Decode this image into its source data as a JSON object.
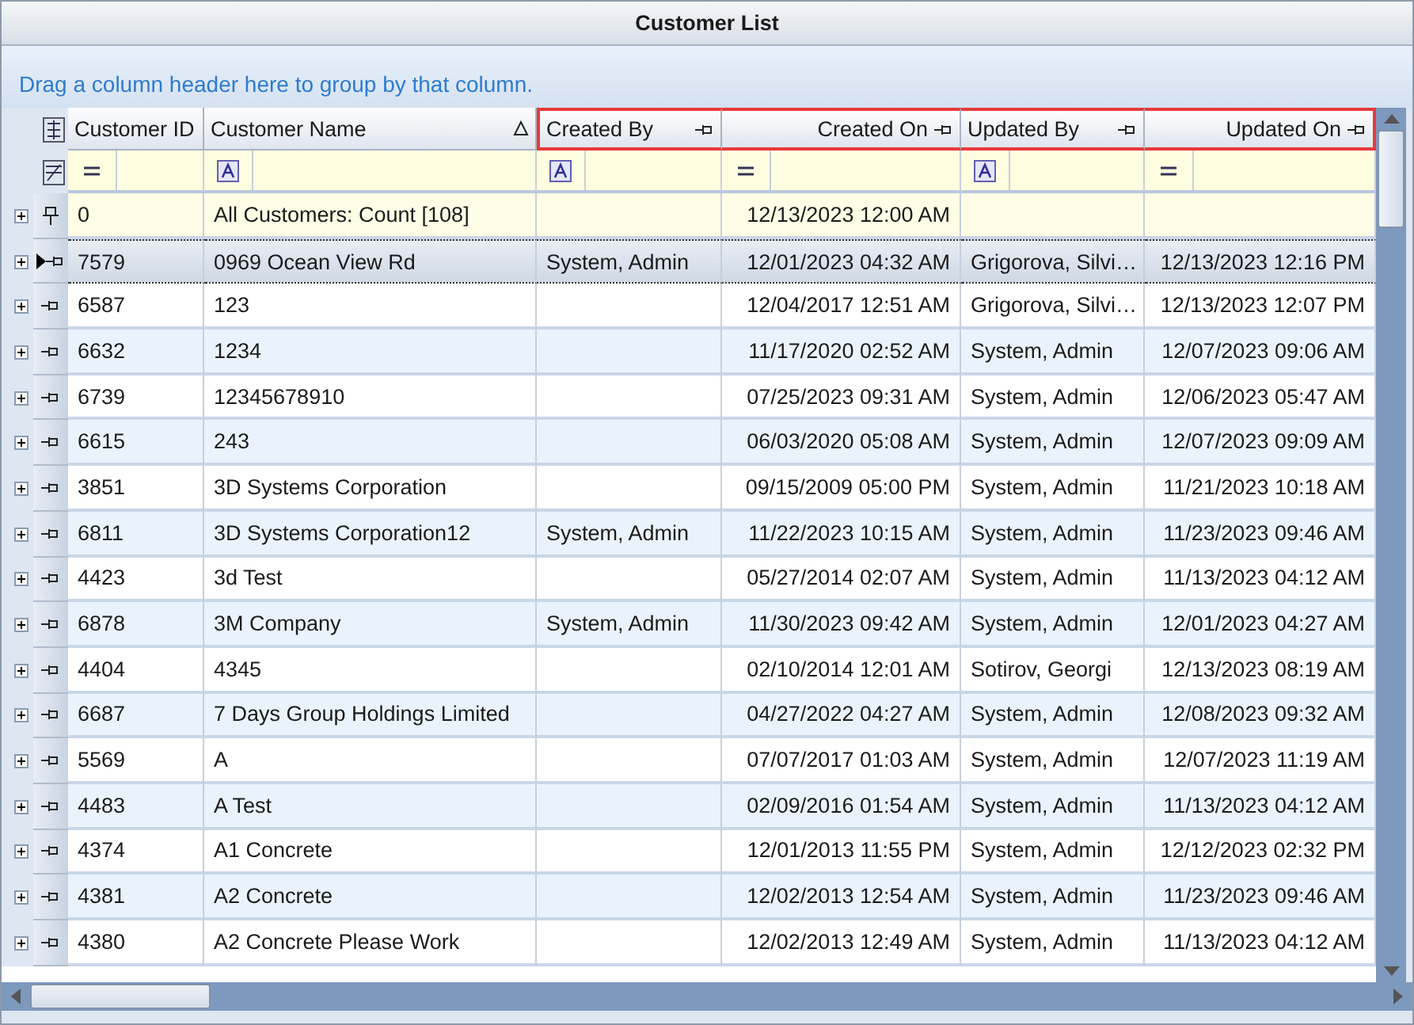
{
  "window": {
    "title": "Customer List"
  },
  "group_panel": {
    "hint": "Drag a column header here to group by that column."
  },
  "columns": [
    {
      "label": "Customer ID",
      "right_aligned": false,
      "sorted": false,
      "pinned": false,
      "highlighted": false
    },
    {
      "label": "Customer Name",
      "right_aligned": false,
      "sorted": true,
      "pinned": false,
      "highlighted": false
    },
    {
      "label": "Created By",
      "right_aligned": false,
      "sorted": false,
      "pinned": true,
      "highlighted": true
    },
    {
      "label": "Created On",
      "right_aligned": true,
      "sorted": false,
      "pinned": true,
      "highlighted": true
    },
    {
      "label": "Updated By",
      "right_aligned": false,
      "sorted": false,
      "pinned": true,
      "highlighted": true
    },
    {
      "label": "Updated On",
      "right_aligned": true,
      "sorted": false,
      "pinned": true,
      "highlighted": true
    }
  ],
  "filter_row": [
    {
      "kind": "equals"
    },
    {
      "kind": "text"
    },
    {
      "kind": "text"
    },
    {
      "kind": "equals"
    },
    {
      "kind": "text"
    },
    {
      "kind": "equals"
    }
  ],
  "rows": [
    {
      "kind": "summary",
      "selected": false,
      "cells": [
        "0",
        "All Customers: Count [108]",
        null,
        "12/13/2023 12:00 AM",
        null,
        null
      ]
    },
    {
      "kind": "data",
      "selected": true,
      "cells": [
        "7579",
        "0969 Ocean View Rd",
        "System, Admin",
        "12/01/2023 04:32 AM",
        "Grigorova, Silvi…",
        "12/13/2023 12:16 PM"
      ]
    },
    {
      "kind": "data",
      "selected": false,
      "cells": [
        "6587",
        "123",
        null,
        "12/04/2017 12:51 AM",
        "Grigorova, Silvi…",
        "12/13/2023 12:07 PM"
      ]
    },
    {
      "kind": "data",
      "selected": false,
      "cells": [
        "6632",
        "1234",
        null,
        "11/17/2020 02:52 AM",
        "System, Admin",
        "12/07/2023 09:06 AM"
      ]
    },
    {
      "kind": "data",
      "selected": false,
      "cells": [
        "6739",
        "12345678910",
        null,
        "07/25/2023 09:31 AM",
        "System, Admin",
        "12/06/2023 05:47 AM"
      ]
    },
    {
      "kind": "data",
      "selected": false,
      "cells": [
        "6615",
        "243",
        null,
        "06/03/2020 05:08 AM",
        "System, Admin",
        "12/07/2023 09:09 AM"
      ]
    },
    {
      "kind": "data",
      "selected": false,
      "cells": [
        "3851",
        "3D Systems Corporation",
        null,
        "09/15/2009 05:00 PM",
        "System, Admin",
        "11/21/2023 10:18 AM"
      ]
    },
    {
      "kind": "data",
      "selected": false,
      "cells": [
        "6811",
        "3D Systems Corporation12",
        "System, Admin",
        "11/22/2023 10:15 AM",
        "System, Admin",
        "11/23/2023 09:46 AM"
      ]
    },
    {
      "kind": "data",
      "selected": false,
      "cells": [
        "4423",
        "3d Test",
        null,
        "05/27/2014 02:07 AM",
        "System, Admin",
        "11/13/2023 04:12 AM"
      ]
    },
    {
      "kind": "data",
      "selected": false,
      "cells": [
        "6878",
        "3M Company",
        "System, Admin",
        "11/30/2023 09:42 AM",
        "System, Admin",
        "12/01/2023 04:27 AM"
      ]
    },
    {
      "kind": "data",
      "selected": false,
      "cells": [
        "4404",
        "4345",
        null,
        "02/10/2014 12:01 AM",
        "Sotirov, Georgi",
        "12/13/2023 08:19 AM"
      ]
    },
    {
      "kind": "data",
      "selected": false,
      "cells": [
        "6687",
        "7 Days Group Holdings Limited",
        null,
        "04/27/2022 04:27 AM",
        "System, Admin",
        "12/08/2023 09:32 AM"
      ]
    },
    {
      "kind": "data",
      "selected": false,
      "cells": [
        "5569",
        "A",
        null,
        "07/07/2017 01:03 AM",
        "System, Admin",
        "12/07/2023 11:19 AM"
      ]
    },
    {
      "kind": "data",
      "selected": false,
      "cells": [
        "4483",
        "A Test",
        null,
        "02/09/2016 01:54 AM",
        "System, Admin",
        "11/13/2023 04:12 AM"
      ]
    },
    {
      "kind": "data",
      "selected": false,
      "cells": [
        "4374",
        "A1 Concrete",
        null,
        "12/01/2013 11:55 PM",
        "System, Admin",
        "12/12/2023 02:32 PM"
      ]
    },
    {
      "kind": "data",
      "selected": false,
      "cells": [
        "4381",
        "A2 Concrete",
        null,
        "12/02/2013 12:54 AM",
        "System, Admin",
        "11/23/2023 09:46 AM"
      ]
    },
    {
      "kind": "data",
      "selected": false,
      "cells": [
        "4380",
        "A2 Concrete Please Work",
        null,
        "12/02/2013 12:49 AM",
        "System, Admin",
        "11/13/2023 04:12 AM"
      ]
    }
  ]
}
